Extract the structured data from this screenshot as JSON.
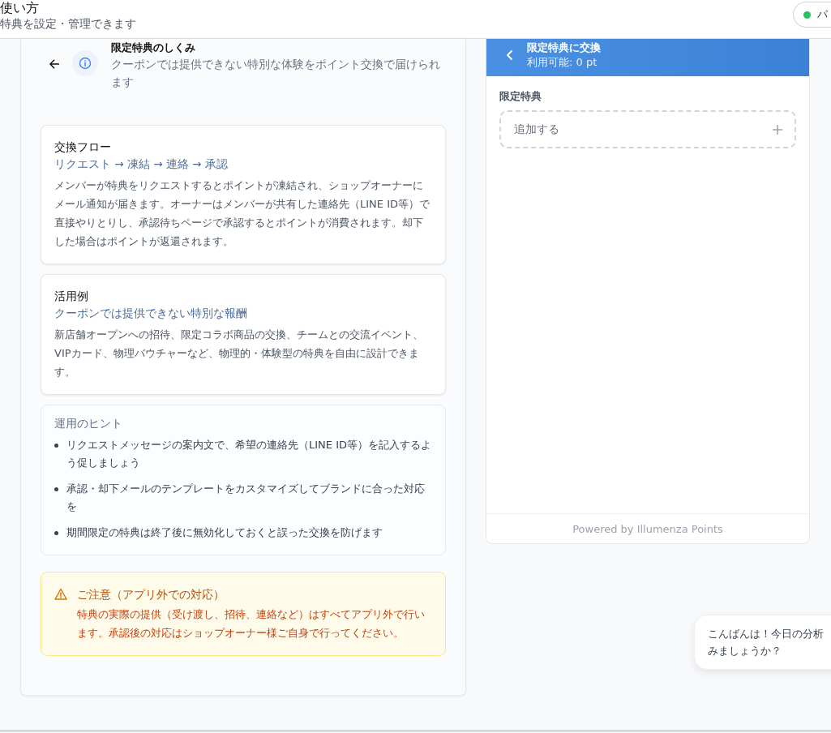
{
  "header": {
    "title": "使い方",
    "subtitle": "特典を設定・管理できます",
    "status_badge": {
      "label": "パ",
      "color": "#22c55e"
    }
  },
  "guide": {
    "title": "限定特典のしくみ",
    "description": "クーポンでは提供できない特別な体験をポイント交換で届けられます",
    "cards": [
      {
        "kind": "card",
        "title": "交換フロー",
        "subtitle": "リクエスト → 凍結 → 連絡 → 承認",
        "body": "メンバーが特典をリクエストするとポイントが凍結され、ショップオーナーにメール通知が届きます。オーナーはメンバーが共有した連絡先（LINE ID等）で直接やりとりし、承認待ちページで承認するとポイントが消費されます。却下した場合はポイントが返還されます。"
      },
      {
        "kind": "card",
        "title": "活用例",
        "subtitle": "クーポンでは提供できない特別な報酬",
        "body": "新店舗オープンへの招待、限定コラボ商品の交換、チームとの交流イベント、VIPカード、物理バウチャーなど、物理的・体験型の特典を自由に設計できます。"
      },
      {
        "kind": "tips",
        "title": "運用のヒント",
        "items": [
          "リクエストメッセージの案内文で、希望の連絡先（LINE ID等）を記入するよう促しましょう",
          "承認・却下メールのテンプレートをカスタマイズしてブランドに合った対応を",
          "期間限定の特典は終了後に無効化しておくと誤った交換を防げます"
        ]
      },
      {
        "kind": "warning",
        "title": "ご注意（アプリ外での対応）",
        "body": "特典の実際の提供（受け渡し、招待、連絡など）はすべてアプリ外で行います。承認後の対応はショップオーナー様ご自身で行ってください。"
      }
    ]
  },
  "preview": {
    "title": "限定特典に交換",
    "points": "利用可能: 0 pt",
    "section_label": "限定特典",
    "add_button": "追加する",
    "footer": "Powered by Illumenza Points"
  },
  "chat_bubble": {
    "lines": [
      "こんばんは！今日の分析",
      "みましょうか？"
    ]
  }
}
